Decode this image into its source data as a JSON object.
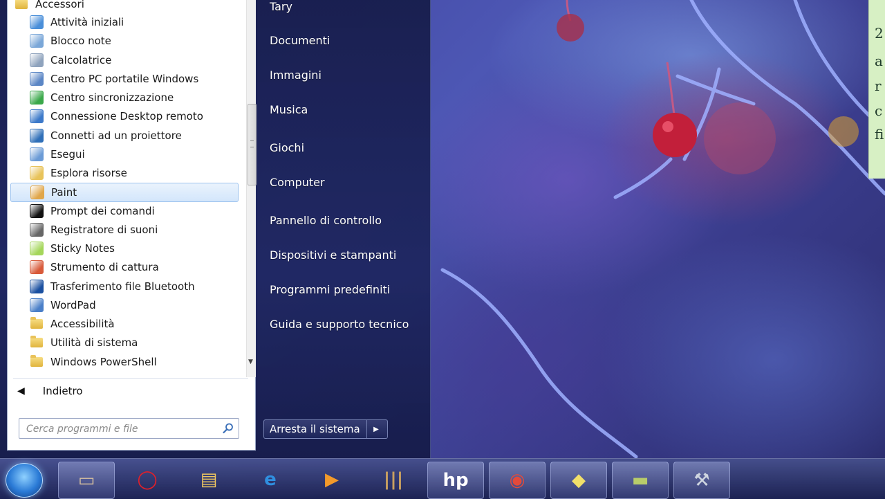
{
  "programs": {
    "folder_header": "Accessori",
    "items": [
      {
        "label": "Attività iniziali",
        "icon": "getting-started-icon",
        "color": "#4a8fd9"
      },
      {
        "label": "Blocco note",
        "icon": "notepad-icon",
        "color": "#7aa7d8"
      },
      {
        "label": "Calcolatrice",
        "icon": "calculator-icon",
        "color": "#8fa3bd"
      },
      {
        "label": "Centro PC portatile Windows",
        "icon": "mobility-center-icon",
        "color": "#5b86c5"
      },
      {
        "label": "Centro sincronizzazione",
        "icon": "sync-center-icon",
        "color": "#3aa84a"
      },
      {
        "label": "Connessione Desktop remoto",
        "icon": "remote-desktop-icon",
        "color": "#3c79c9"
      },
      {
        "label": "Connetti ad un proiettore",
        "icon": "projector-icon",
        "color": "#2f6fb8"
      },
      {
        "label": "Esegui",
        "icon": "run-icon",
        "color": "#6b9bd6"
      },
      {
        "label": "Esplora risorse",
        "icon": "explorer-icon",
        "color": "#e8c35a"
      },
      {
        "label": "Paint",
        "icon": "paint-icon",
        "color": "#e0a64a"
      },
      {
        "label": "Prompt dei comandi",
        "icon": "command-prompt-icon",
        "color": "#111111"
      },
      {
        "label": "Registratore di suoni",
        "icon": "sound-recorder-icon",
        "color": "#666666"
      },
      {
        "label": "Sticky Notes",
        "icon": "sticky-notes-icon",
        "color": "#a4d65a"
      },
      {
        "label": "Strumento di cattura",
        "icon": "snipping-tool-icon",
        "color": "#d85a3a"
      },
      {
        "label": "Trasferimento file Bluetooth",
        "icon": "bluetooth-icon",
        "color": "#1a4fa0"
      },
      {
        "label": "WordPad",
        "icon": "wordpad-icon",
        "color": "#4a7fc8"
      },
      {
        "label": "Accessibilità",
        "icon": "folder-icon",
        "color": "#e8c35a"
      },
      {
        "label": "Utilità di sistema",
        "icon": "folder-icon",
        "color": "#e8c35a"
      },
      {
        "label": "Windows PowerShell",
        "icon": "folder-icon",
        "color": "#e8c35a"
      }
    ],
    "selected": "Paint",
    "back_label": "Indietro",
    "search_placeholder": "Cerca programmi e file"
  },
  "right_column": {
    "items": [
      "Tary",
      "Documenti",
      "Immagini",
      "Musica",
      "Giochi",
      "Computer",
      "Pannello di controllo",
      "Dispositivi e stampanti",
      "Programmi predefiniti",
      "Guida e supporto tecnico"
    ],
    "shutdown_label": "Arresta il sistema"
  },
  "sticky_note": {
    "lines": [
      "2",
      "a",
      "r",
      "c",
      "fi"
    ],
    "color": "#d7f0c4"
  },
  "taskbar": {
    "apps": [
      {
        "name": "start-orb-icon"
      },
      {
        "name": "desktop-app-icon"
      },
      {
        "name": "opera-icon"
      },
      {
        "name": "file-explorer-icon"
      },
      {
        "name": "internet-explorer-icon"
      },
      {
        "name": "media-player-icon"
      },
      {
        "name": "library-icon"
      },
      {
        "name": "hp-icon"
      },
      {
        "name": "chrome-icon"
      },
      {
        "name": "sticky-notes-taskbar-icon"
      },
      {
        "name": "notes-app-icon"
      },
      {
        "name": "tool-app-icon"
      }
    ]
  }
}
